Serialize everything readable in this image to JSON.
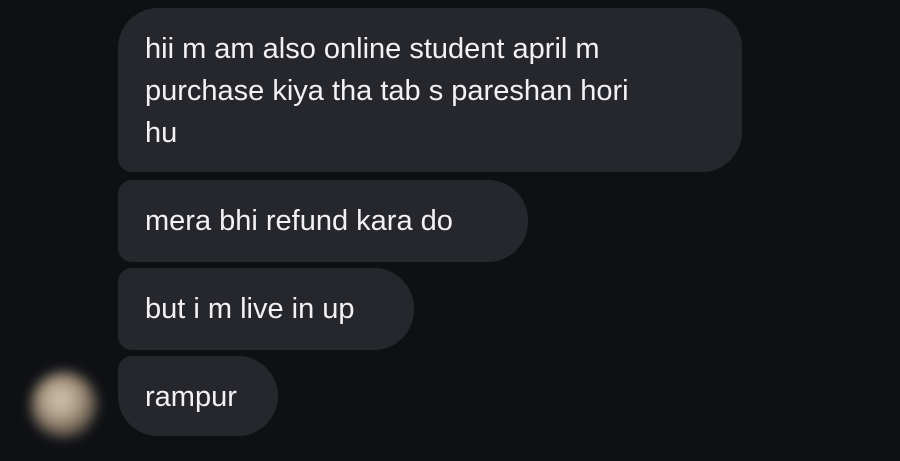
{
  "conversation": {
    "messages": [
      {
        "lines": [
          "hii m am also online student april m",
          "purchase kiya tha tab s pareshan hori",
          "hu"
        ]
      },
      {
        "lines": [
          "mera bhi refund kara do"
        ]
      },
      {
        "lines": [
          "but i m live in up"
        ]
      },
      {
        "lines": [
          "rampur"
        ]
      }
    ]
  },
  "colors": {
    "background": "#0e1014",
    "bubble": "#26272c",
    "text": "#f2f2f4"
  },
  "icons": {
    "avatar": "blurred-profile-avatar"
  }
}
